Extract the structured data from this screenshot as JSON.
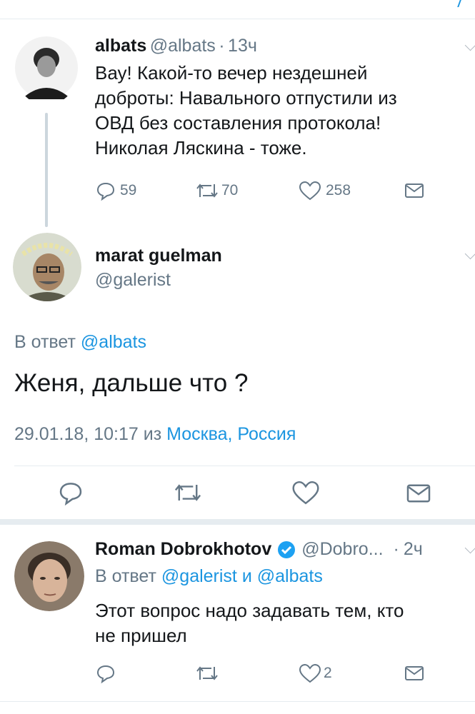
{
  "tweet1": {
    "name": "albats",
    "handle": "@albats",
    "separator": "·",
    "time": "13ч",
    "text_lines": [
      "Вау! Какой-то вечер нездешней",
      "доброты: Навального отпустили из",
      "ОВД без составления протокола!",
      "Николая Ляскина - тоже."
    ],
    "replies": "59",
    "retweets": "70",
    "likes": "258"
  },
  "main": {
    "name": "marat guelman",
    "handle": "@galerist",
    "reply_label": "В ответ",
    "reply_to": "@albats",
    "text": "Женя, дальше что ?",
    "date": "29.01.18, 10:17",
    "from_label": "из",
    "location": "Москва, Россия"
  },
  "tweet3": {
    "name": "Roman Dobrokhotov",
    "handle": "@Dobro...",
    "separator": "·",
    "time": "2ч",
    "reply_label": "В ответ",
    "reply_to_1": "@galerist",
    "and_label": "и",
    "reply_to_2": "@albats",
    "text_lines": [
      "Этот вопрос надо задавать тем, кто",
      "не пришел"
    ],
    "likes": "2"
  },
  "colors": {
    "accent": "#1b95e0",
    "muted": "#657786",
    "verified": "#1da1f2"
  }
}
